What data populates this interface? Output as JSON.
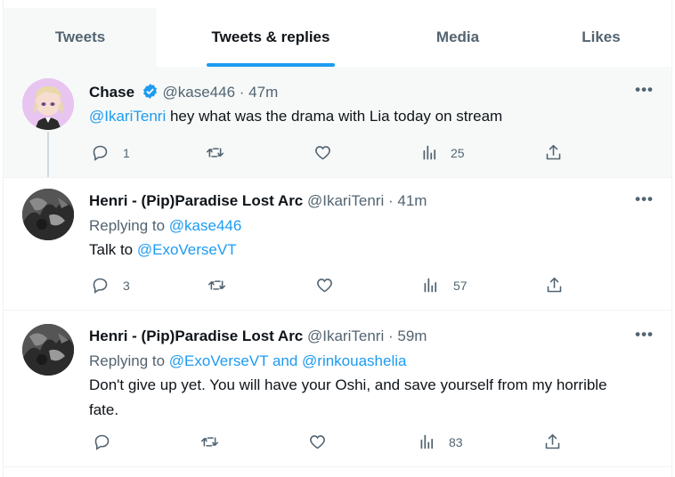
{
  "tabs": [
    {
      "label": "Tweets"
    },
    {
      "label": "Tweets & replies"
    },
    {
      "label": "Media"
    },
    {
      "label": "Likes"
    }
  ],
  "colors": {
    "accent": "#1d9bf0",
    "muted": "#536471",
    "text": "#0f1419",
    "highlight_bg": "#f7f9f9"
  },
  "tweets": [
    {
      "author_name": "Chase",
      "verified": true,
      "handle": "@kase446",
      "sep": "·",
      "time": "47m",
      "mention": "@IkariTenri",
      "text": " hey what was the drama with Lia today on stream",
      "replies": "1",
      "views": "25"
    },
    {
      "author_name": "Henri - (Pip)Paradise Lost Arc",
      "handle": "@IkariTenri",
      "sep": "·",
      "time": "41m",
      "replying_label": "Replying to ",
      "replying_to": "@kase446",
      "text_prefix": "Talk to ",
      "mention": "@ExoVerseVT",
      "replies": "3",
      "views": "57"
    },
    {
      "author_name": "Henri - (Pip)Paradise Lost Arc",
      "handle": "@IkariTenri",
      "sep": "·",
      "time": "59m",
      "replying_label": "Replying to ",
      "replying_to": "@ExoVerseVT and @rinkouashelia",
      "text": "Don't give up yet. You will have your Oshi, and save yourself from my horrible fate.",
      "views": "83"
    }
  ],
  "icons": [
    "reply-icon",
    "retweet-icon",
    "like-icon",
    "views-icon",
    "share-icon",
    "more-icon",
    "verified-icon"
  ]
}
